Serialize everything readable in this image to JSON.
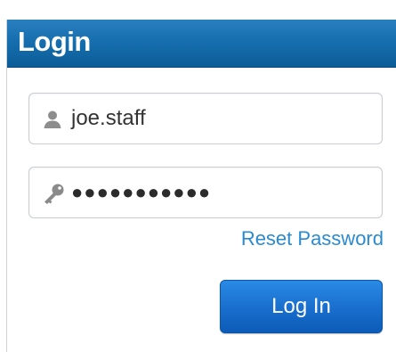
{
  "header": {
    "title": "Login"
  },
  "username": {
    "value": "joe.staff",
    "icon": "user-icon"
  },
  "password": {
    "value": "●●●●●●●●●●●",
    "icon": "key-icon"
  },
  "links": {
    "reset_password": "Reset Password"
  },
  "actions": {
    "login_label": "Log In"
  },
  "colors": {
    "header": "#176fb0",
    "link": "#2a8ad0",
    "button": "#1a70cf"
  }
}
